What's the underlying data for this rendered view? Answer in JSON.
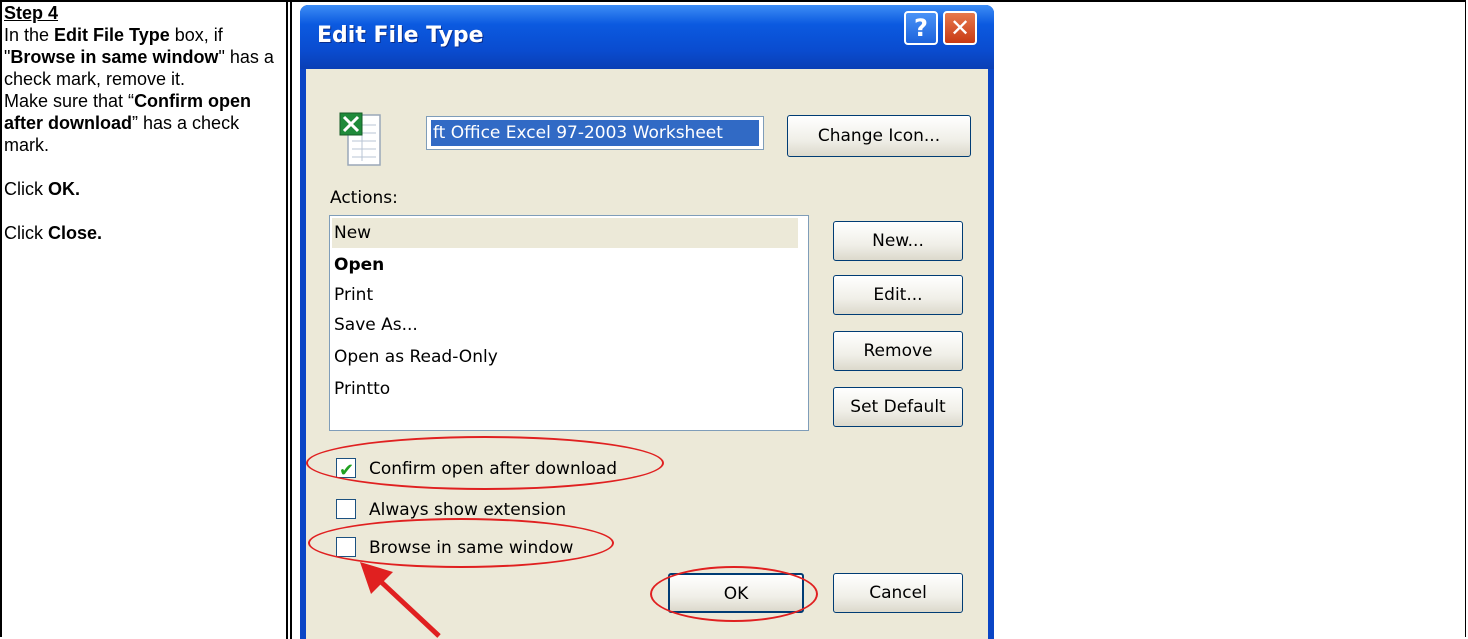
{
  "instructions": {
    "step": "Step 4",
    "p1_a": "In the ",
    "p1_b": "Edit File Type",
    "p1_c": " box, if \"",
    "p1_d": "Browse in same window",
    "p1_e": "\" has a check mark, remove it.",
    "p2_a": "Make sure that “",
    "p2_b": "Confirm open after download",
    "p2_c": "” has a check mark.",
    "p3_a": "Click ",
    "p3_b": "OK.",
    "p4_a": "Click ",
    "p4_b": "Close."
  },
  "dialog": {
    "title": "Edit File Type",
    "help_label": "?",
    "close_label": "✕",
    "description_value": "ft Office Excel 97-2003 Worksheet",
    "change_icon_label": "Change Icon...",
    "actions_label": "Actions:",
    "actions": [
      "New",
      "Open",
      "Print",
      "Save As...",
      "Open as Read-Only",
      "Printto"
    ],
    "new_label": "New...",
    "edit_label": "Edit...",
    "remove_label": "Remove",
    "set_default_label": "Set Default",
    "confirm_open_label": "Confirm open after download",
    "confirm_open_checked": true,
    "always_show_ext_label": "Always show extension",
    "always_show_ext_checked": false,
    "browse_same_window_label": "Browse in same window",
    "browse_same_window_checked": false,
    "ok_label": "OK",
    "cancel_label": "Cancel",
    "check_glyph": "✔"
  },
  "colors": {
    "title_bar": "#0a4cd0",
    "dialog_face": "#ece9d8",
    "selection": "#316ac5",
    "annotation": "#e02020"
  }
}
